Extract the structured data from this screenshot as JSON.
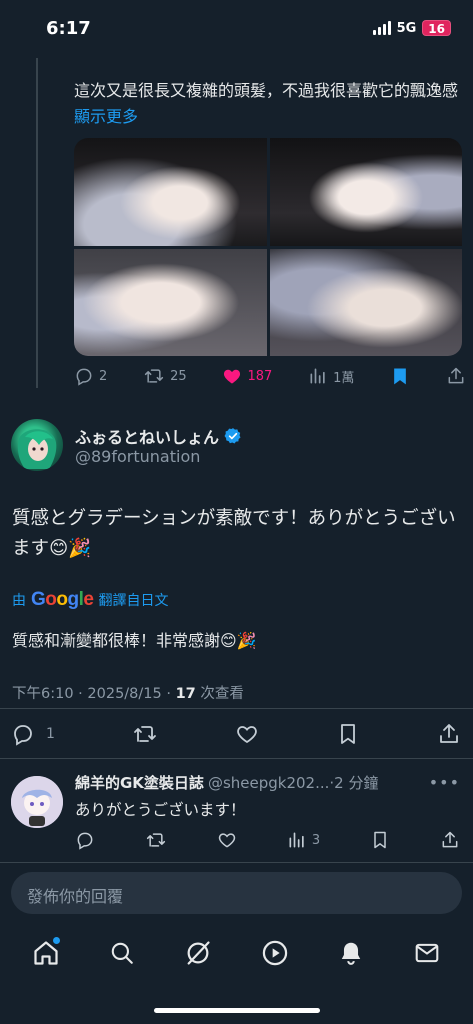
{
  "status_bar": {
    "time": "6:17",
    "network": "5G",
    "battery": "16"
  },
  "parent_tweet": {
    "text": "這次又是很長又複雜的頭髮，不過我很喜歡它的飄逸感",
    "show_more": "顯示更多",
    "actions": {
      "replies": "2",
      "reposts": "25",
      "likes": "187",
      "views": "1萬"
    },
    "like_color": "#f91880"
  },
  "main_tweet": {
    "display_name": "ふぉるとねいしょん",
    "handle": "@89fortunation",
    "text": "質感とグラデーションが素敵です！ありがとうございます😊🎉",
    "translate": {
      "prefix": "由",
      "google": "Google",
      "label": "翻譯自日文"
    },
    "translated_text": "質感和漸變都很棒！非常感謝😊🎉",
    "meta": {
      "time": "下午6:10 · 2025/8/15 · ",
      "views": "17",
      "views_label": " 次查看"
    },
    "actions": {
      "replies": "1"
    }
  },
  "reply": {
    "display_name": "綿羊的GK塗裝日誌",
    "handle": "@sheepgk202...",
    "time": "·2 分鐘",
    "text": "ありがとうございます！",
    "views": "3"
  },
  "composer": {
    "placeholder": "發佈你的回覆"
  },
  "nav": [
    "home-icon",
    "search-icon",
    "grok-icon",
    "video-icon",
    "notifications-icon",
    "messages-icon"
  ],
  "colors": {
    "background": "#15202b",
    "accent": "#1d9bf0",
    "muted": "#8b98a5"
  }
}
